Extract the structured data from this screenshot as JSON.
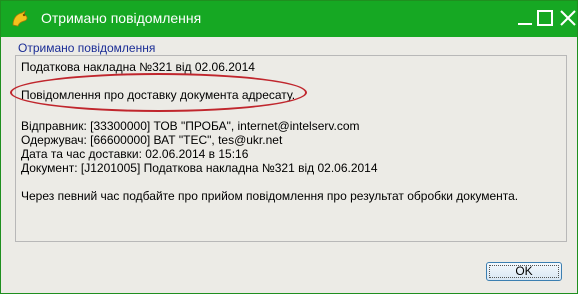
{
  "window": {
    "title": "Отримано повідомлення",
    "title_icon": "app-icon",
    "title_bar_color": "#16a823"
  },
  "section_label": "Отримано повідомлення",
  "message": {
    "invoice": "Податкова накладна  №321 від 02.06.2014",
    "notice": "Повідомлення про доставку документа адресату.",
    "sender": "Відправник: [33300000] ТОВ \"ПРОБА\", internet@intelserv.com",
    "recipient": "Одержувач:  [66600000] ВАТ \"ТЕС\", tes@ukr.net",
    "delivery_time": "Дата та час доставки: 02.06.2014 в 15:16",
    "document": "Документ: [J1201005] Податкова накладна  №321 від 02.06.2014",
    "followup": "Через певний час подбайте про прийом повідомлення про результат обробки документа."
  },
  "buttons": {
    "ok_label": "OK"
  }
}
